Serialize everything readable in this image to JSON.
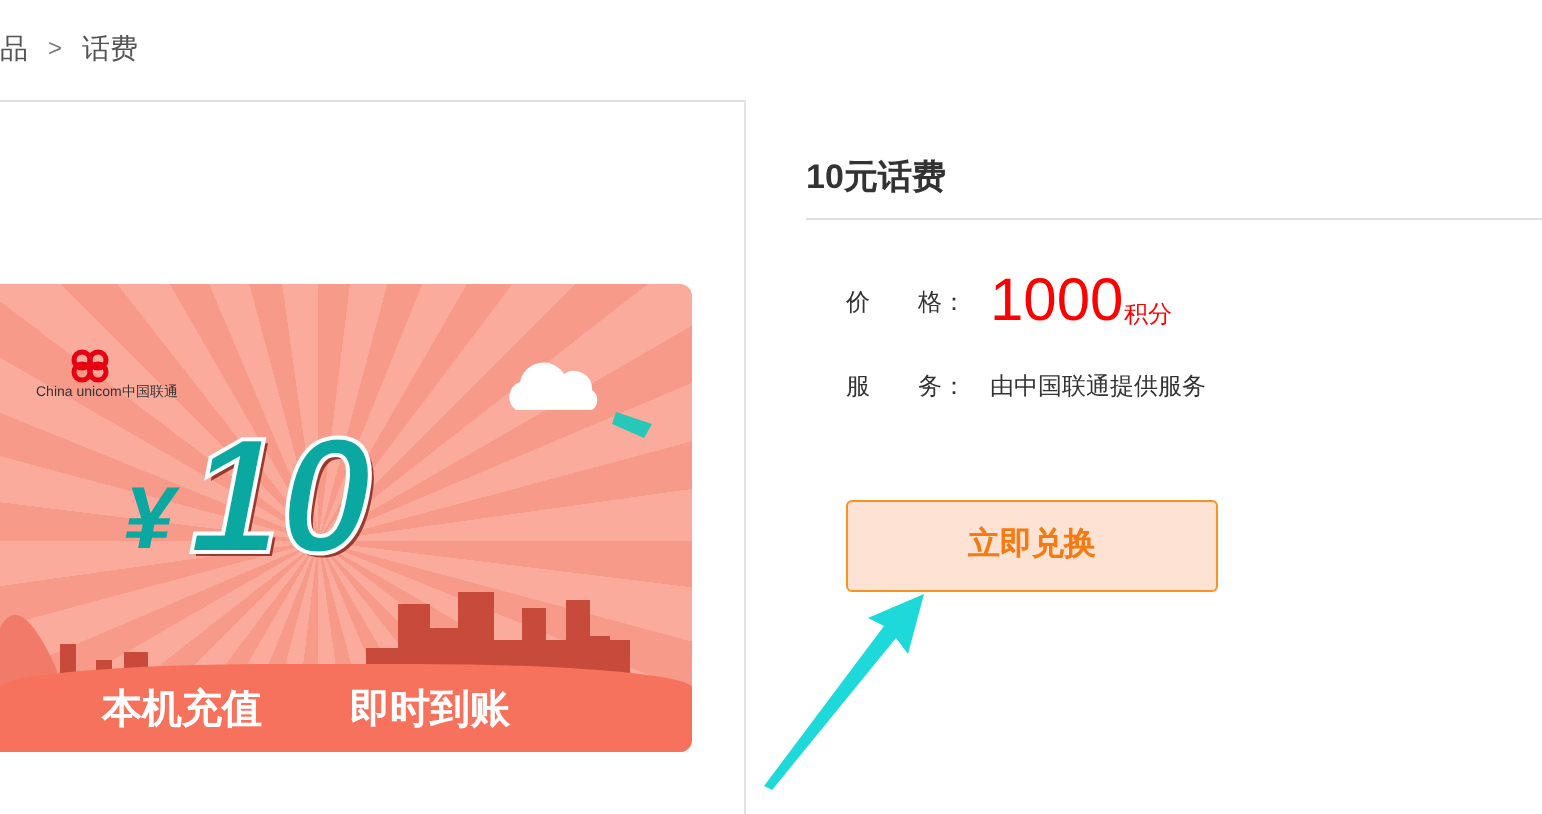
{
  "breadcrumb": {
    "items": [
      "品",
      "话费"
    ],
    "separator": ">"
  },
  "banner": {
    "logo_text": "China unicom中国联通",
    "currency": "¥",
    "amount": "10",
    "captions": [
      "本机充值",
      "即时到账"
    ]
  },
  "product": {
    "title": "10元话费",
    "price": {
      "label": "价　　格：",
      "value": "1000",
      "unit": "积分"
    },
    "service": {
      "label": "服　　务：",
      "value": "由中国联通提供服务"
    },
    "button": "立即兑换"
  }
}
